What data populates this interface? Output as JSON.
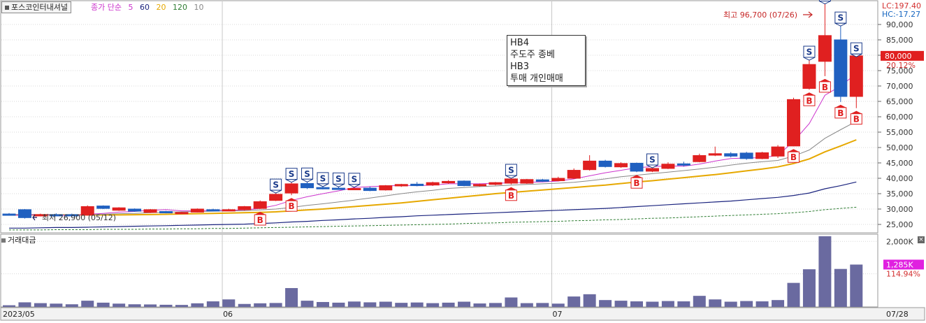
{
  "window": {
    "title_tab": "포스코인터내셔널"
  },
  "legend": {
    "prefix": "종가 단순",
    "ma": [
      {
        "label": "5",
        "color": "#cc33cc"
      },
      {
        "label": "60",
        "color": "#1a237e"
      },
      {
        "label": "20",
        "color": "#e6a800"
      },
      {
        "label": "120",
        "color": "#2e7d32"
      },
      {
        "label": "10",
        "color": "#888888"
      }
    ]
  },
  "right_info": {
    "lc": "LC:197.40",
    "hc": "HC:-17.27",
    "price_tag": "80,000",
    "price_change": "20.12%",
    "vol_tag": "1,285K",
    "vol_change": "114.94%"
  },
  "annotations": {
    "high": "최고 96,700 (07/26)",
    "low": "최저 26,900 (05/12)"
  },
  "memo": [
    "HB4",
    "주도주 종베",
    "HB3",
    "투매 개인매매"
  ],
  "volume_panel": {
    "title": "거래대금"
  },
  "colors": {
    "up": "#e02020",
    "down": "#2060c0",
    "ma5": "#cc33cc",
    "ma10": "#888888",
    "ma20": "#e6a800",
    "ma60": "#1a237e",
    "ma120": "#2e7d32",
    "volume": "#6a6aa0",
    "grid": "#d8d8d8",
    "tag_bg": "#e02020",
    "vol_tag_bg": "#e020e0"
  },
  "chart_data": {
    "type": "candlestick",
    "price_axis": {
      "ticks": [
        "25,000",
        "30,000",
        "35,000",
        "40,000",
        "45,000",
        "50,000",
        "55,000",
        "60,000",
        "65,000",
        "70,000",
        "75,000",
        "80,000",
        "85,000",
        "90,000"
      ],
      "ylim": [
        22500,
        97500
      ]
    },
    "volume_axis": {
      "ticks": [
        "2,000K"
      ],
      "ylim": [
        0,
        2200
      ]
    },
    "x_labels": [
      "2023/05",
      "06",
      "07",
      "07/28"
    ],
    "month_breaks": [
      14,
      35
    ],
    "candles": [
      {
        "o": 28400,
        "h": 28700,
        "l": 28000,
        "c": 28000,
        "v": 30
      },
      {
        "o": 29800,
        "h": 30000,
        "l": 26900,
        "c": 27200,
        "v": 120
      },
      {
        "o": 28000,
        "h": 28500,
        "l": 27600,
        "c": 28200,
        "v": 95
      },
      {
        "o": 28200,
        "h": 28600,
        "l": 27800,
        "c": 28100,
        "v": 80
      },
      {
        "o": 28200,
        "h": 28500,
        "l": 27800,
        "c": 28000,
        "v": 60
      },
      {
        "o": 28000,
        "h": 31200,
        "l": 27900,
        "c": 30800,
        "v": 170
      },
      {
        "o": 31000,
        "h": 31200,
        "l": 30000,
        "c": 30200,
        "v": 110
      },
      {
        "o": 29600,
        "h": 30600,
        "l": 29400,
        "c": 30400,
        "v": 80
      },
      {
        "o": 30000,
        "h": 30200,
        "l": 29100,
        "c": 29300,
        "v": 60
      },
      {
        "o": 28900,
        "h": 30000,
        "l": 28700,
        "c": 29800,
        "v": 55
      },
      {
        "o": 29200,
        "h": 29400,
        "l": 28600,
        "c": 28800,
        "v": 45
      },
      {
        "o": 28700,
        "h": 29100,
        "l": 28500,
        "c": 28900,
        "v": 40
      },
      {
        "o": 29000,
        "h": 30200,
        "l": 28900,
        "c": 30000,
        "v": 90
      },
      {
        "o": 29800,
        "h": 30100,
        "l": 29500,
        "c": 29600,
        "v": 150
      },
      {
        "o": 29600,
        "h": 30100,
        "l": 29300,
        "c": 29800,
        "v": 210
      },
      {
        "o": 29800,
        "h": 31000,
        "l": 29500,
        "c": 30800,
        "v": 70
      },
      {
        "o": 30200,
        "h": 32800,
        "l": 30000,
        "c": 32400,
        "v": 90
      },
      {
        "o": 32800,
        "h": 35200,
        "l": 32600,
        "c": 34800,
        "v": 100
      },
      {
        "o": 35200,
        "h": 38700,
        "l": 34500,
        "c": 38200,
        "v": 560
      },
      {
        "o": 38300,
        "h": 38800,
        "l": 36500,
        "c": 36900,
        "v": 170
      },
      {
        "o": 37000,
        "h": 37300,
        "l": 36400,
        "c": 36700,
        "v": 130
      },
      {
        "o": 36800,
        "h": 37200,
        "l": 36400,
        "c": 36600,
        "v": 110
      },
      {
        "o": 36700,
        "h": 37100,
        "l": 36300,
        "c": 36700,
        "v": 145
      },
      {
        "o": 36800,
        "h": 37300,
        "l": 35800,
        "c": 36000,
        "v": 120
      },
      {
        "o": 36200,
        "h": 37800,
        "l": 36000,
        "c": 37600,
        "v": 140
      },
      {
        "o": 37500,
        "h": 38200,
        "l": 37200,
        "c": 38000,
        "v": 105
      },
      {
        "o": 38100,
        "h": 38800,
        "l": 37400,
        "c": 37600,
        "v": 115
      },
      {
        "o": 37800,
        "h": 38900,
        "l": 37500,
        "c": 38600,
        "v": 95
      },
      {
        "o": 38500,
        "h": 39400,
        "l": 38200,
        "c": 39000,
        "v": 110
      },
      {
        "o": 39100,
        "h": 39300,
        "l": 37400,
        "c": 37600,
        "v": 140
      },
      {
        "o": 37600,
        "h": 38300,
        "l": 37300,
        "c": 38000,
        "v": 85
      },
      {
        "o": 38000,
        "h": 38800,
        "l": 37700,
        "c": 38600,
        "v": 100
      },
      {
        "o": 38400,
        "h": 40000,
        "l": 38000,
        "c": 39800,
        "v": 270
      },
      {
        "o": 38400,
        "h": 39800,
        "l": 38200,
        "c": 39600,
        "v": 95
      },
      {
        "o": 39500,
        "h": 39800,
        "l": 38800,
        "c": 39000,
        "v": 100
      },
      {
        "o": 39200,
        "h": 40500,
        "l": 39000,
        "c": 40000,
        "v": 80
      },
      {
        "o": 40000,
        "h": 43200,
        "l": 39800,
        "c": 42600,
        "v": 300
      },
      {
        "o": 42800,
        "h": 47500,
        "l": 42500,
        "c": 45600,
        "v": 370
      },
      {
        "o": 45600,
        "h": 46000,
        "l": 43500,
        "c": 43800,
        "v": 190
      },
      {
        "o": 43700,
        "h": 45200,
        "l": 43400,
        "c": 44800,
        "v": 170
      },
      {
        "o": 44900,
        "h": 45100,
        "l": 42000,
        "c": 42300,
        "v": 150
      },
      {
        "o": 42300,
        "h": 43400,
        "l": 42000,
        "c": 43200,
        "v": 140
      },
      {
        "o": 43200,
        "h": 45200,
        "l": 43000,
        "c": 44600,
        "v": 160
      },
      {
        "o": 44700,
        "h": 45400,
        "l": 43800,
        "c": 44500,
        "v": 150
      },
      {
        "o": 45400,
        "h": 48000,
        "l": 45200,
        "c": 47400,
        "v": 320
      },
      {
        "o": 47500,
        "h": 50300,
        "l": 47200,
        "c": 48000,
        "v": 210
      },
      {
        "o": 48000,
        "h": 48500,
        "l": 46800,
        "c": 47200,
        "v": 140
      },
      {
        "o": 48200,
        "h": 48600,
        "l": 46000,
        "c": 46400,
        "v": 160
      },
      {
        "o": 46400,
        "h": 48600,
        "l": 46200,
        "c": 48300,
        "v": 150
      },
      {
        "o": 47200,
        "h": 50800,
        "l": 46600,
        "c": 50200,
        "v": 190
      },
      {
        "o": 50500,
        "h": 66200,
        "l": 50400,
        "c": 65600,
        "v": 720
      },
      {
        "o": 69200,
        "h": 78400,
        "l": 68800,
        "c": 77000,
        "v": 1140
      },
      {
        "o": 78000,
        "h": 96700,
        "l": 73200,
        "c": 86400,
        "v": 2160
      },
      {
        "o": 85000,
        "h": 89500,
        "l": 64800,
        "c": 66600,
        "v": 1150
      },
      {
        "o": 66600,
        "h": 79500,
        "l": 62800,
        "c": 79800,
        "v": 1285
      }
    ],
    "signals": [
      {
        "i": 16,
        "type": "B"
      },
      {
        "i": 17,
        "type": "S"
      },
      {
        "i": 18,
        "type": "B"
      },
      {
        "i": 18,
        "type": "S"
      },
      {
        "i": 19,
        "type": "S"
      },
      {
        "i": 20,
        "type": "S"
      },
      {
        "i": 21,
        "type": "S"
      },
      {
        "i": 22,
        "type": "S"
      },
      {
        "i": 32,
        "type": "S"
      },
      {
        "i": 32,
        "type": "B"
      },
      {
        "i": 40,
        "type": "B"
      },
      {
        "i": 41,
        "type": "S"
      },
      {
        "i": 50,
        "type": "B"
      },
      {
        "i": 51,
        "type": "B"
      },
      {
        "i": 51,
        "type": "S"
      },
      {
        "i": 52,
        "type": "S"
      },
      {
        "i": 52,
        "type": "B"
      },
      {
        "i": 53,
        "type": "S"
      },
      {
        "i": 53,
        "type": "B"
      },
      {
        "i": 54,
        "type": "S"
      },
      {
        "i": 54,
        "type": "B"
      }
    ],
    "ma_lines": {
      "ma5": [
        28000,
        28000,
        28200,
        28000,
        27900,
        28300,
        28600,
        29000,
        29200,
        29600,
        29800,
        29400,
        29400,
        29600,
        29600,
        29700,
        30200,
        31200,
        32800,
        34000,
        35000,
        35900,
        37000,
        37300,
        37500,
        37700,
        37600,
        37800,
        38200,
        38200,
        38200,
        38400,
        38500,
        38700,
        38800,
        39100,
        39800,
        40800,
        41800,
        42600,
        43400,
        43800,
        44000,
        43900,
        44600,
        45600,
        46400,
        46600,
        46700,
        47400,
        52000,
        57800,
        67000,
        70000,
        74000
      ],
      "ma10": [
        28200,
        28200,
        28200,
        28100,
        28100,
        28200,
        28300,
        28500,
        28600,
        28800,
        29000,
        29100,
        29200,
        29300,
        29400,
        29500,
        29700,
        30000,
        30500,
        31200,
        31700,
        32300,
        32900,
        33600,
        34300,
        35000,
        35600,
        36100,
        36700,
        37000,
        37300,
        37500,
        37800,
        38000,
        38200,
        38400,
        38700,
        39200,
        39800,
        40500,
        41000,
        41500,
        42000,
        42500,
        43000,
        43600,
        44300,
        44900,
        45400,
        45800,
        47200,
        49200,
        53000,
        55800,
        58500
      ],
      "ma20": [
        28100,
        28100,
        28100,
        28100,
        28100,
        28100,
        28100,
        28100,
        28150,
        28200,
        28300,
        28400,
        28500,
        28600,
        28700,
        28800,
        28900,
        29100,
        29400,
        29700,
        30000,
        30400,
        30800,
        31200,
        31600,
        32000,
        32500,
        33000,
        33500,
        34000,
        34500,
        35000,
        35400,
        35800,
        36200,
        36600,
        37000,
        37400,
        37800,
        38300,
        38800,
        39200,
        39700,
        40200,
        40700,
        41200,
        41800,
        42400,
        43000,
        43700,
        44800,
        46300,
        48600,
        50500,
        52500
      ],
      "ma60": [
        23800,
        23800,
        23900,
        24000,
        24000,
        24100,
        24200,
        24300,
        24400,
        24500,
        24600,
        24700,
        24800,
        24900,
        25000,
        25100,
        25300,
        25500,
        25800,
        26000,
        26300,
        26500,
        26800,
        27000,
        27300,
        27500,
        27800,
        28000,
        28200,
        28400,
        28600,
        28800,
        29000,
        29200,
        29400,
        29600,
        29800,
        30000,
        30200,
        30500,
        30800,
        31100,
        31400,
        31700,
        32000,
        32300,
        32600,
        33000,
        33400,
        33800,
        34400,
        35200,
        36600,
        37600,
        38800
      ],
      "ma120": [
        23200,
        23200,
        23200,
        23300,
        23300,
        23300,
        23400,
        23400,
        23400,
        23500,
        23500,
        23600,
        23600,
        23700,
        23700,
        23800,
        23900,
        24000,
        24100,
        24200,
        24300,
        24400,
        24500,
        24600,
        24700,
        24800,
        24900,
        25000,
        25100,
        25300,
        25400,
        25500,
        25700,
        25800,
        25900,
        26000,
        26200,
        26300,
        26500,
        26600,
        26800,
        27000,
        27100,
        27300,
        27500,
        27700,
        27900,
        28100,
        28300,
        28500,
        28800,
        29200,
        29800,
        30200,
        30600
      ]
    }
  }
}
